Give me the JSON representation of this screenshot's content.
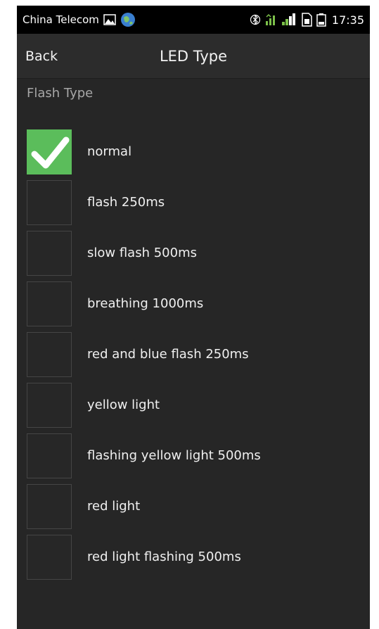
{
  "status_bar": {
    "carrier": "China Telecom",
    "time": "17:35",
    "icons": [
      "image-icon",
      "globe-icon",
      "bluetooth-icon",
      "network-icon",
      "signal-icon",
      "sim-icon",
      "battery-icon"
    ]
  },
  "action_bar": {
    "back_label": "Back",
    "title": "LED Type"
  },
  "section": {
    "title": "Flash Type"
  },
  "colors": {
    "checked": "#5bbd5b",
    "background": "#262626"
  },
  "options": [
    {
      "label": "normal",
      "checked": true
    },
    {
      "label": "flash 250ms",
      "checked": false
    },
    {
      "label": "slow flash 500ms",
      "checked": false
    },
    {
      "label": "breathing 1000ms",
      "checked": false
    },
    {
      "label": "red and blue flash 250ms",
      "checked": false
    },
    {
      "label": "yellow light",
      "checked": false
    },
    {
      "label": "flashing yellow light 500ms",
      "checked": false
    },
    {
      "label": "red light",
      "checked": false
    },
    {
      "label": "red light flashing 500ms",
      "checked": false
    }
  ]
}
